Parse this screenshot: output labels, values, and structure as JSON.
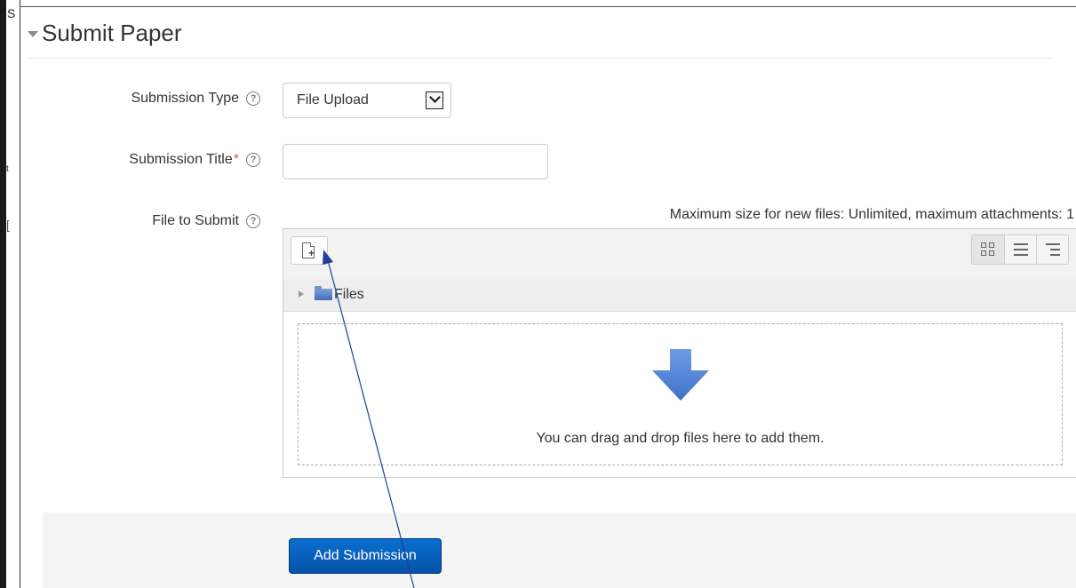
{
  "section": {
    "title": "Submit Paper"
  },
  "fields": {
    "submission_type": {
      "label": "Submission Type",
      "value": "File Upload",
      "help": "?"
    },
    "submission_title": {
      "label": "Submission Title",
      "required_mark": "*",
      "value": "",
      "help": "?"
    },
    "file_to_submit": {
      "label": "File to Submit",
      "help": "?"
    }
  },
  "filepicker": {
    "limits_text": "Maximum size for new files: Unlimited, maximum attachments: 1",
    "path_label": "Files",
    "drop_hint": "You can drag and drop files here to add them.",
    "icons": {
      "add_file": "add-file-icon",
      "view_icons": "grid-view-icon",
      "view_list": "list-view-icon",
      "view_tree": "tree-view-icon",
      "folder": "folder-icon",
      "drop": "down-arrow-icon"
    }
  },
  "actions": {
    "add_submission": "Add Submission"
  },
  "edge_fragments": {
    "top": "S",
    "mid": "t",
    "lower": "["
  },
  "colors": {
    "primary_button": "#0552a8",
    "required": "#d9534f",
    "annotation": "#1f3f9a",
    "folder": "#3f6fb8",
    "drop_arrow": "#4a7fd4"
  }
}
